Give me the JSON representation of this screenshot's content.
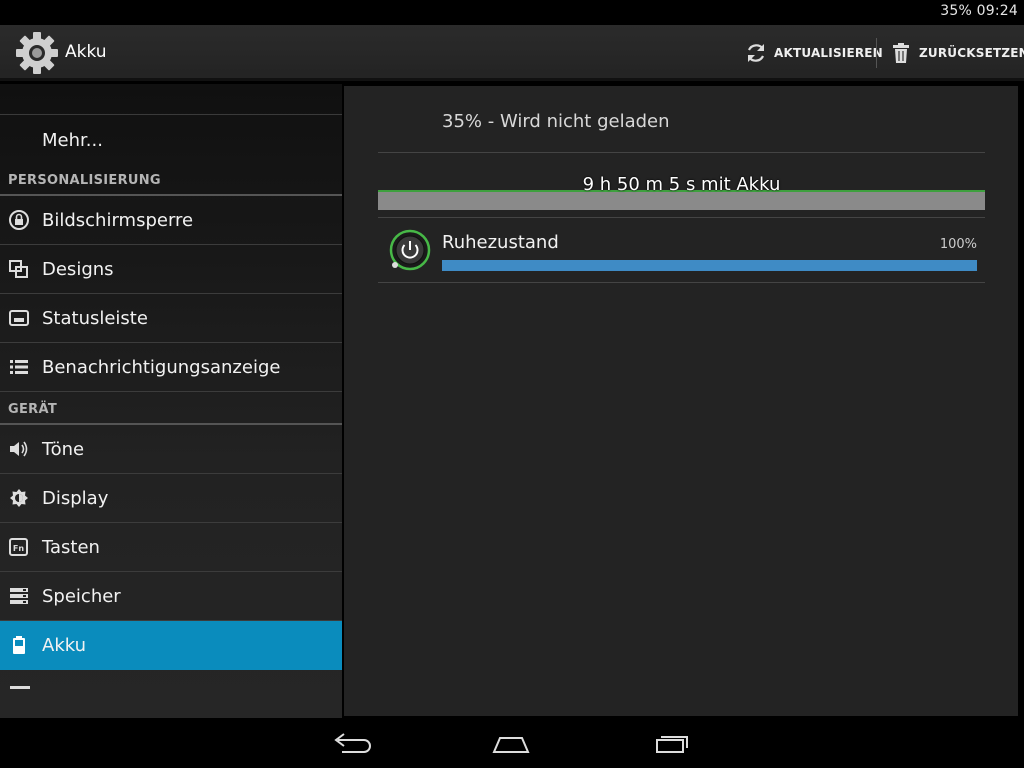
{
  "status_bar": {
    "battery": "35%",
    "time": "09:24"
  },
  "action_bar": {
    "title": "Akku",
    "app_icon": "settings-gear-icon",
    "refresh_label": "AKTUALISIEREN",
    "reset_label": "ZURÜCKSETZEN"
  },
  "sidebar": {
    "more_label": "Mehr...",
    "section_personal": "PERSONALISIERUNG",
    "personal_items": [
      {
        "label": "Bildschirmsperre",
        "icon": "lock-icon"
      },
      {
        "label": "Designs",
        "icon": "designs-icon"
      },
      {
        "label": "Statusleiste",
        "icon": "statusbar-icon"
      },
      {
        "label": "Benachrichtigungsanzeige",
        "icon": "list-icon"
      }
    ],
    "section_device": "GERÄT",
    "device_items": [
      {
        "label": "Töne",
        "icon": "speaker-icon"
      },
      {
        "label": "Display",
        "icon": "brightness-icon"
      },
      {
        "label": "Tasten",
        "icon": "fn-key-icon"
      },
      {
        "label": "Speicher",
        "icon": "storage-icon"
      },
      {
        "label": "Akku",
        "icon": "battery-icon",
        "active": true
      }
    ]
  },
  "content": {
    "charge_status": "35% - Wird nicht geladen",
    "battery_time": "9 h 50 m 5 s mit Akku",
    "usage": [
      {
        "name": "Ruhezustand",
        "percent_label": "100%",
        "percent": 100,
        "icon": "power-standby-icon"
      }
    ]
  },
  "colors": {
    "accent_active": "#0a8cbd",
    "usage_bar": "#3f8bc5",
    "graph_line": "#3ea03e"
  }
}
